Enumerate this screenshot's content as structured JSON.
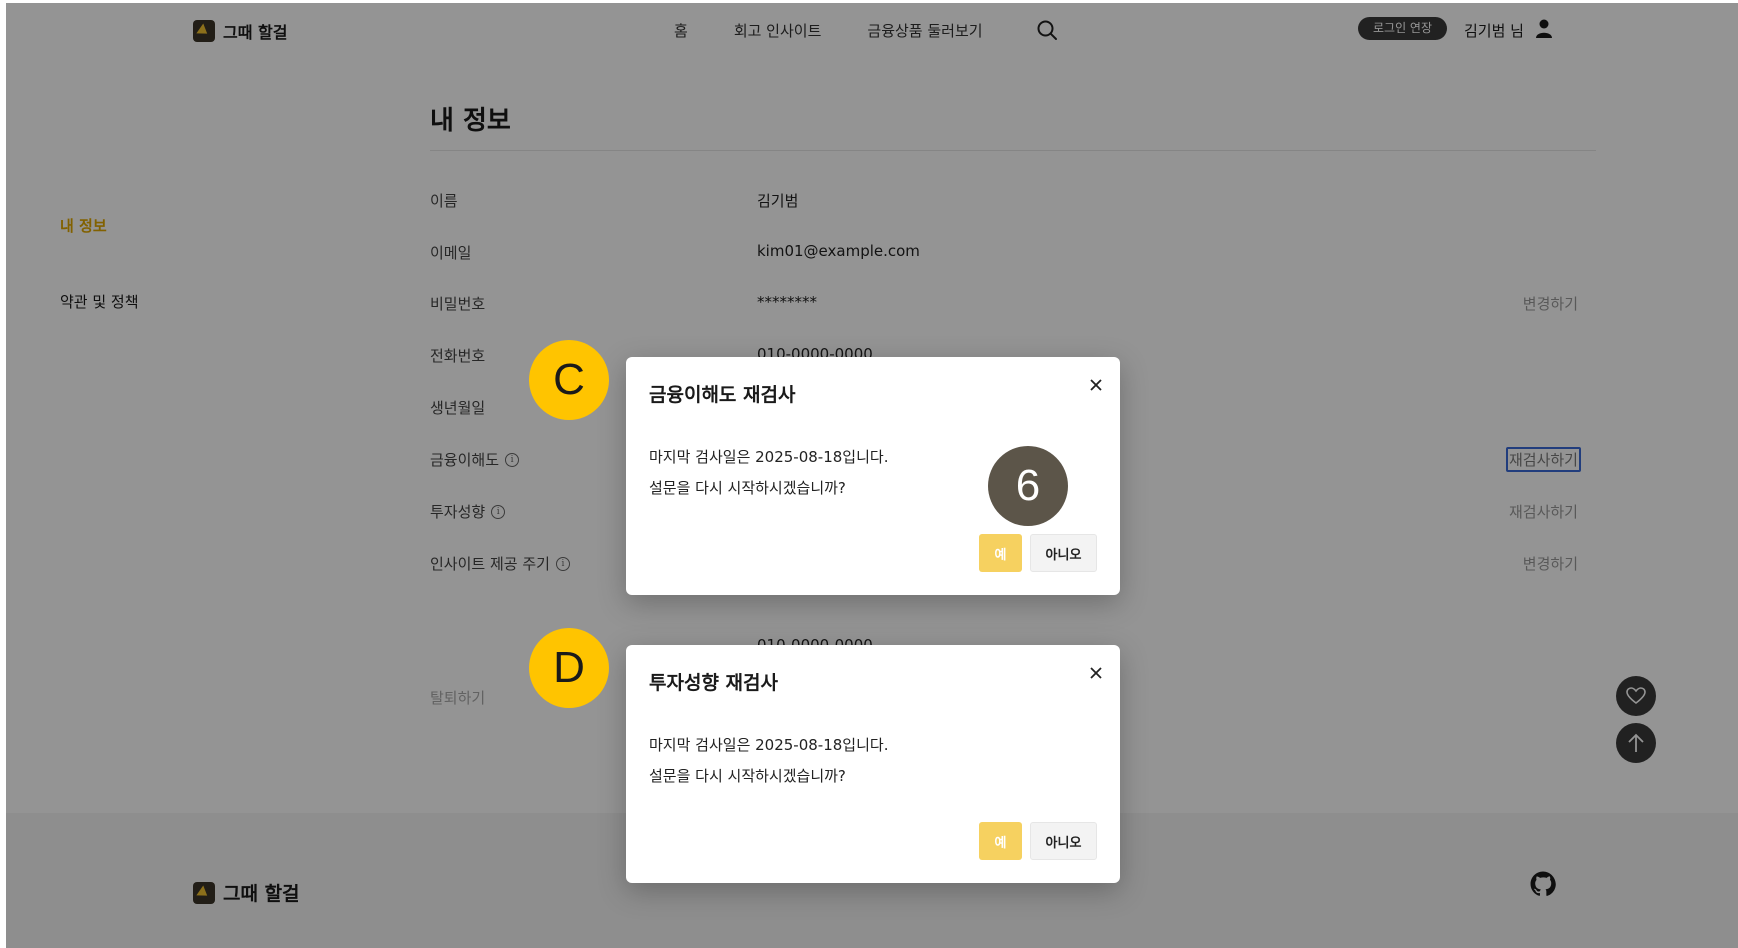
{
  "header": {
    "logo_text": "그때 할걸",
    "nav": [
      "홈",
      "회고 인사이트",
      "금융상품 둘러보기"
    ],
    "login_extend": "로그인 연장",
    "user_name": "김기범 님"
  },
  "sidebar": {
    "items": [
      {
        "label": "내 정보"
      },
      {
        "label": "약관 및 정책"
      }
    ]
  },
  "main": {
    "title": "내 정보",
    "rows": [
      {
        "label": "이름",
        "value": "김기범",
        "action": ""
      },
      {
        "label": "이메일",
        "value": "kim01@example.com",
        "action": ""
      },
      {
        "label": "비밀번호",
        "value": "********",
        "action": "변경하기"
      },
      {
        "label": "전화번호",
        "value": "010-0000-0000",
        "action": ""
      },
      {
        "label": "생년월일",
        "value": "",
        "action": ""
      },
      {
        "label": "금융이해도",
        "value": "",
        "action": "재검사하기"
      },
      {
        "label": "투자성향",
        "value": "",
        "action": "재검사하기"
      },
      {
        "label": "인사이트 제공 주기",
        "value": "",
        "action": "변경하기"
      }
    ],
    "ghost_phone": "010-0000-0000",
    "withdraw": "탈퇴하기"
  },
  "footer": {
    "logo_text": "그때 할걸"
  },
  "modals": [
    {
      "title": "금융이해도 재검사",
      "line1": "마지막 검사일은 2025-08-18입니다.",
      "line2": "설문을 다시 시작하시겠습니까?",
      "yes": "예",
      "no": "아니오"
    },
    {
      "title": "투자성향 재검사",
      "line1": "마지막 검사일은 2025-08-18입니다.",
      "line2": "설문을 다시 시작하시겠습니까?",
      "yes": "예",
      "no": "아니오"
    }
  ],
  "markers": {
    "c": "C",
    "d": "D",
    "six": "6"
  },
  "colors": {
    "accent": "#e0a800",
    "yes_button": "#f6d160",
    "marker_yellow": "#ffc400",
    "marker_dark": "#5c5549",
    "dark": "#3a3a3a"
  }
}
